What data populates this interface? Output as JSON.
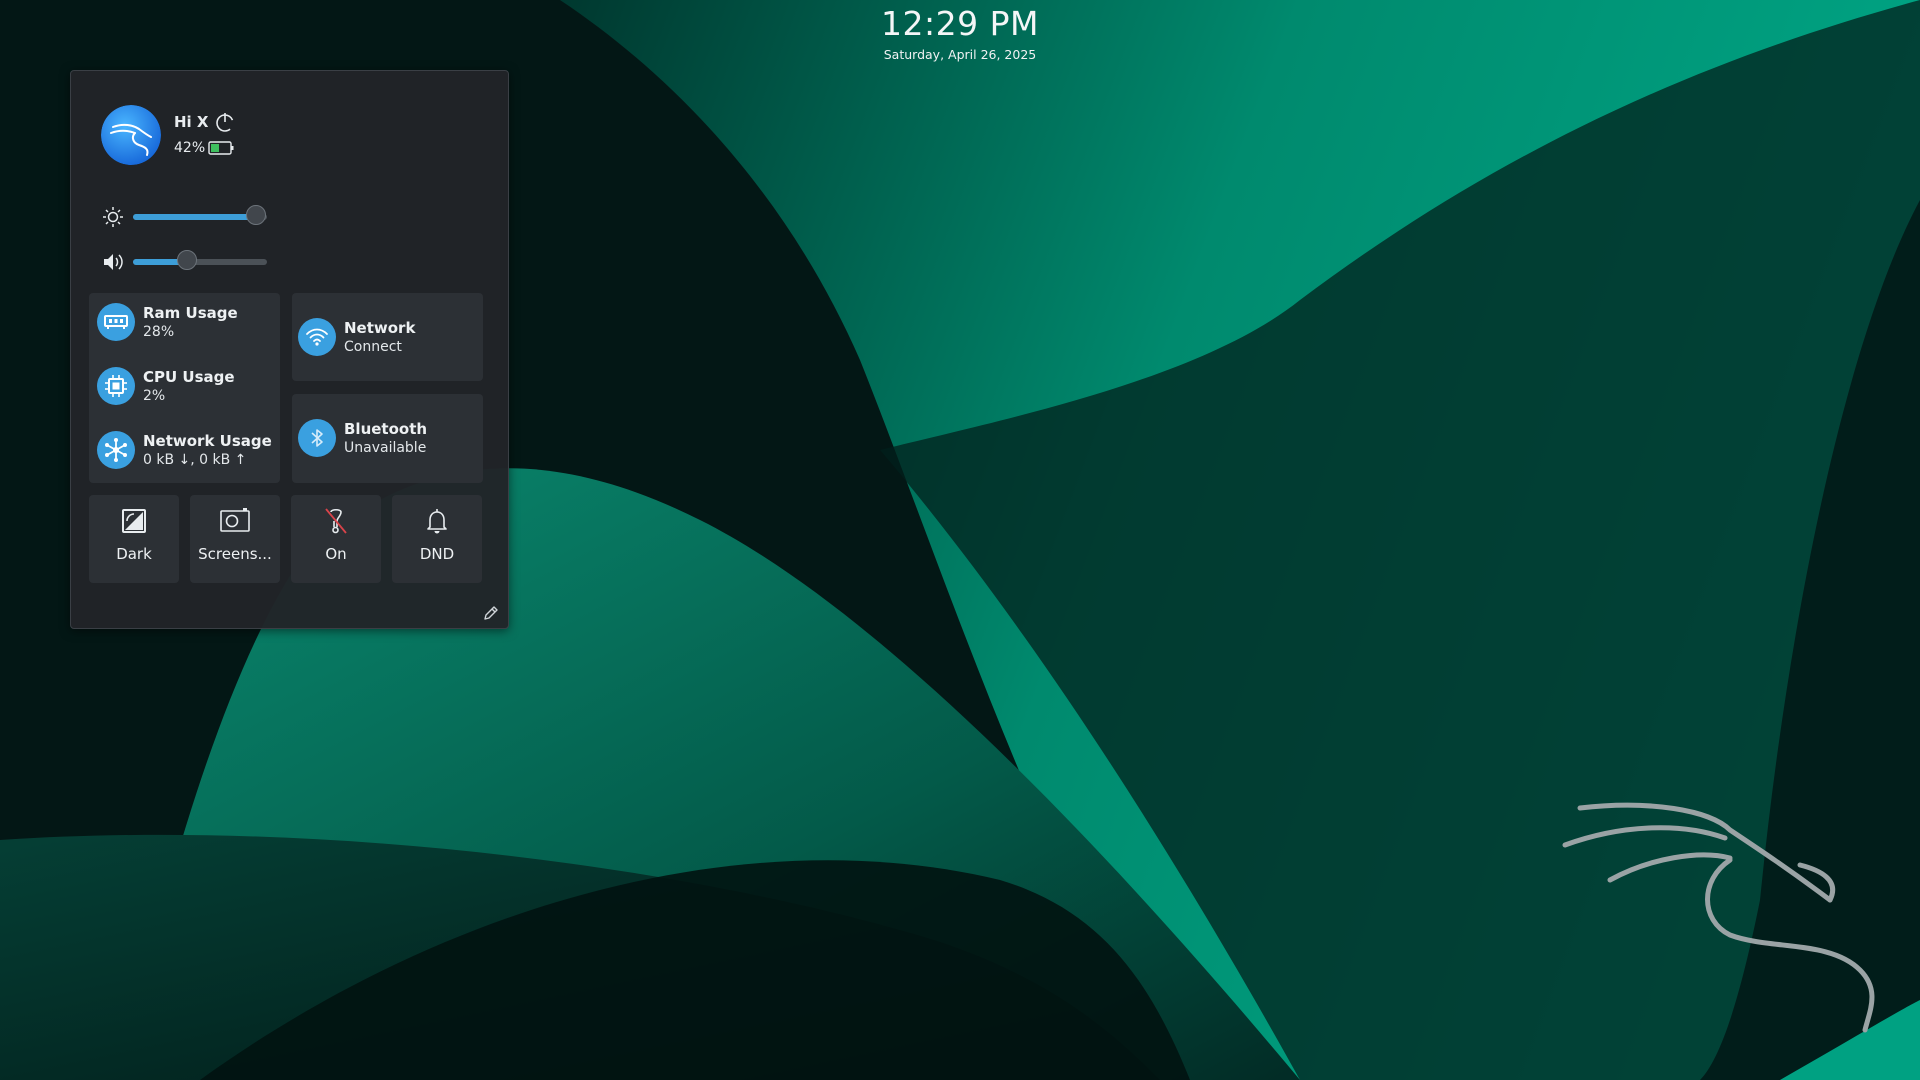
{
  "clock": {
    "time": "12:29 PM",
    "date": "Saturday, April 26, 2025"
  },
  "user": {
    "greeting": "Hi X",
    "battery": "42%"
  },
  "sliders": {
    "brightness_level": 0.92,
    "volume_level": 0.4
  },
  "stats": [
    {
      "title": "Ram Usage",
      "value": "28%"
    },
    {
      "title": "CPU Usage",
      "value": "2%"
    },
    {
      "title": "Network Usage",
      "value": "0 kB ↓, 0 kB ↑"
    }
  ],
  "network": {
    "title": "Network",
    "status": "Connect"
  },
  "bluetooth": {
    "title": "Bluetooth",
    "status": "Unavailable"
  },
  "toggles": [
    {
      "label": "Dark"
    },
    {
      "label": "Screens..."
    },
    {
      "label": "On"
    },
    {
      "label": "DND"
    }
  ],
  "colors": {
    "accent": "#3aa0e0",
    "panel": "#212428",
    "wallpaper_green": "#00a182"
  }
}
